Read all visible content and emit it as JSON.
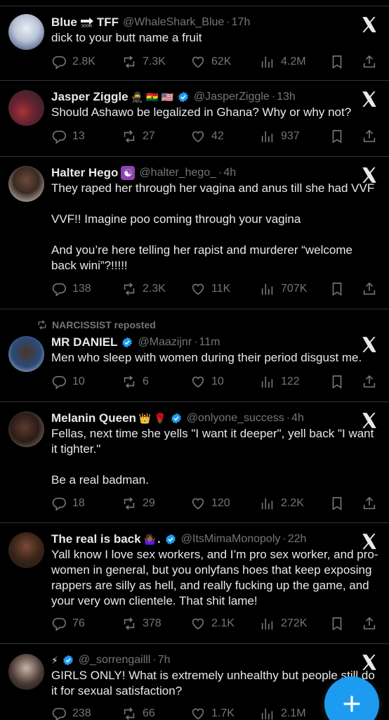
{
  "tweets": [
    {
      "name": "Blue",
      "name_suffix": "TFF",
      "handle": "@WhaleShark_Blue",
      "time": "17h",
      "text": "dick to your butt name a fruit",
      "replies": "2.8K",
      "reposts": "7.3K",
      "likes": "62K",
      "views": "4.2M"
    },
    {
      "name": "Jasper Ziggle",
      "handle": "@JasperZiggle",
      "time": "13h",
      "text": "Should Ashawo be legalized in Ghana? Why or why not?",
      "replies": "13",
      "reposts": "27",
      "likes": "42",
      "views": "937"
    },
    {
      "name": "Halter Hego",
      "handle": "@halter_hego_",
      "time": "4h",
      "text": "They raped her through her vagina and anus till she had VVF\n\nVVF!! Imagine poo coming through your vagina\n\nAnd you’re here telling her rapist and murderer “welcome back wini”?!!!!!",
      "replies": "138",
      "reposts": "2.3K",
      "likes": "11K",
      "views": "707K"
    },
    {
      "repost_by": "NARCISSIST reposted",
      "name": "MR DANIEL",
      "handle": "@Maazijnr",
      "time": "11m",
      "text": "Men who sleep with women during their period disgust me.",
      "replies": "10",
      "reposts": "6",
      "likes": "10",
      "views": "122"
    },
    {
      "name": "Melanin Queen",
      "handle": "@onlyone_success",
      "time": "4h",
      "text": "Fellas, next time she yells \"I want it deeper\", yell back \"I want it tighter.\"\n\nBe a real badman.",
      "replies": "18",
      "reposts": "29",
      "likes": "120",
      "views": "2.2K"
    },
    {
      "name": "The real is back",
      "name_suffix": ".",
      "handle": "@ItsMimaMonopoly",
      "time": "22h",
      "text": "Yall know I love sex workers, and I’m pro sex worker, and pro- women in general, but you onlyfans hoes that keep exposing rappers are silly as hell, and really fucking up the game, and your very own clientele. That shit lame!",
      "replies": "76",
      "reposts": "378",
      "likes": "2.1K",
      "views": "272K"
    },
    {
      "name": "⚡",
      "handle": "@_sorrengailll",
      "time": "7h",
      "text": "GIRLS ONLY! What is extremely unhealthy but people still do it for sexual satisfaction?",
      "replies": "238",
      "reposts": "66",
      "likes": "1.7K",
      "views": "2.1M"
    }
  ],
  "icons": {
    "reply": "reply-icon",
    "repost": "repost-icon",
    "like": "heart-icon",
    "views": "views-icon",
    "bookmark": "bookmark-icon",
    "share": "share-icon",
    "x_logo": "x-logo-icon",
    "fab": "plus-icon"
  },
  "colors": {
    "background": "#000000",
    "muted": "#71767b",
    "accent": "#1d9bf0",
    "divider": "#2f3336"
  }
}
